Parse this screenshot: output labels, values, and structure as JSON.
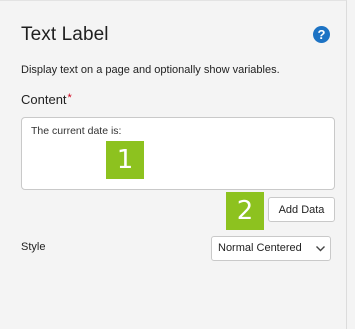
{
  "panel": {
    "title": "Text Label",
    "help_glyph": "?",
    "description": "Display text on a page and optionally show variables.",
    "content_label": "Content",
    "required_marker": "*",
    "content_value": "The current date is:",
    "add_data_label": "Add Data",
    "style_label": "Style",
    "style_selected": "Normal Centered"
  },
  "callouts": {
    "one": "1",
    "two": "2"
  },
  "icons": {
    "help": "help-icon",
    "dropdown": "chevron-down-icon"
  },
  "colors": {
    "callout_green": "#8dc21f",
    "help_blue": "#1d73c4",
    "required_red": "#d0021b"
  }
}
